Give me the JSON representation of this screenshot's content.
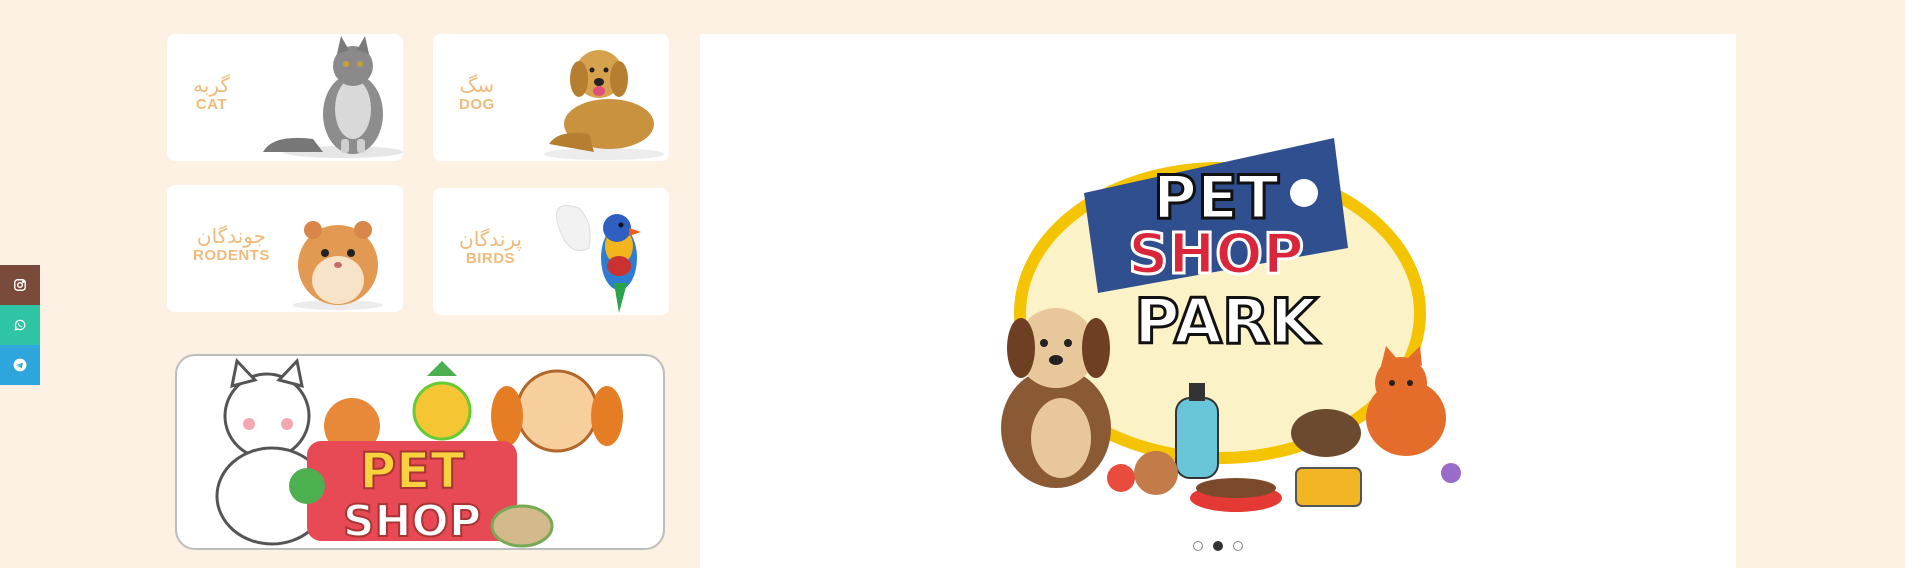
{
  "social": [
    {
      "name": "instagram-icon"
    },
    {
      "name": "whatsapp-icon"
    },
    {
      "name": "telegram-icon"
    }
  ],
  "categories": {
    "cat": {
      "fa": "گربه",
      "en": "CAT"
    },
    "dog": {
      "fa": "سگ",
      "en": "DOG"
    },
    "rodents": {
      "fa": "جوندگان",
      "en": "RODENTS"
    },
    "birds": {
      "fa": "پرندگان",
      "en": "BIRDS"
    }
  },
  "banner": {
    "line1": "PET",
    "line2": "SHOP"
  },
  "slider": {
    "logo_line1": "PET",
    "logo_line2": "SHOP",
    "logo_line3": "PARK",
    "active_slide": 2,
    "slide_count": 3
  },
  "colors": {
    "page_bg": "#fdf1e4",
    "category_text": "#f0bb7a",
    "instagram": "#7a4a3a",
    "whatsapp": "#2fc4a3",
    "telegram": "#2ea6dd"
  }
}
